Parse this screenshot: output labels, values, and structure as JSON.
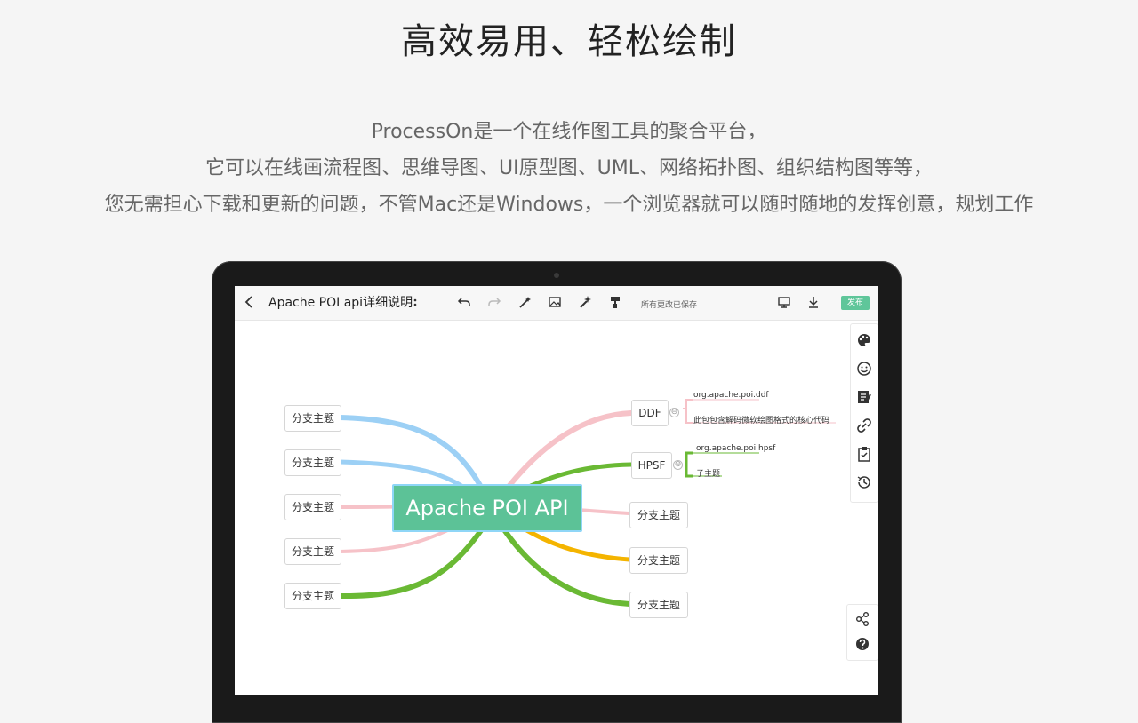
{
  "headline": "高效易用、轻松绘制",
  "intro": [
    "ProcessOn是一个在线作图工具的聚合平台，",
    "它可以在线画流程图、思维导图、UI原型图、UML、网络拓扑图、组织结构图等等，",
    "您无需担心下载和更新的问题，不管Mac还是Windows，一个浏览器就可以随时随地的发挥创意，规划工作"
  ],
  "editor": {
    "doc_title": "Apache POI api详细说明",
    "save_status": "所有更改已保存",
    "publish_label": "发布",
    "colors": {
      "accent": "#5fc69a",
      "root_fill": "#5cc297",
      "root_border": "#8fd6f7"
    },
    "toolbar_icons": [
      "back-icon",
      "more-icon",
      "undo-icon",
      "redo-icon",
      "magic-wand-icon",
      "image-icon",
      "sparkle-icon",
      "format-brush-icon",
      "present-icon",
      "download-icon"
    ],
    "side_icons": [
      "palette-icon",
      "emoji-icon",
      "note-icon",
      "link-icon",
      "clipboard-icon",
      "history-icon"
    ],
    "side_icons_bottom": [
      "share-icon",
      "help-icon"
    ]
  },
  "mindmap": {
    "root": "Apache POI API",
    "left_nodes": [
      "分支主题",
      "分支主题",
      "分支主题",
      "分支主题",
      "分支主题"
    ],
    "right_nodes": [
      {
        "label": "DDF",
        "children": [
          "org.apache.poi.ddf",
          "此包包含解码微软绘图格式的核心代码"
        ]
      },
      {
        "label": "HPSF",
        "children": [
          "org.apache.poi.hpsf",
          "子主题"
        ]
      },
      {
        "label": "分支主题"
      },
      {
        "label": "分支主题"
      },
      {
        "label": "分支主题"
      }
    ],
    "collapse_symbol": "⊖"
  }
}
